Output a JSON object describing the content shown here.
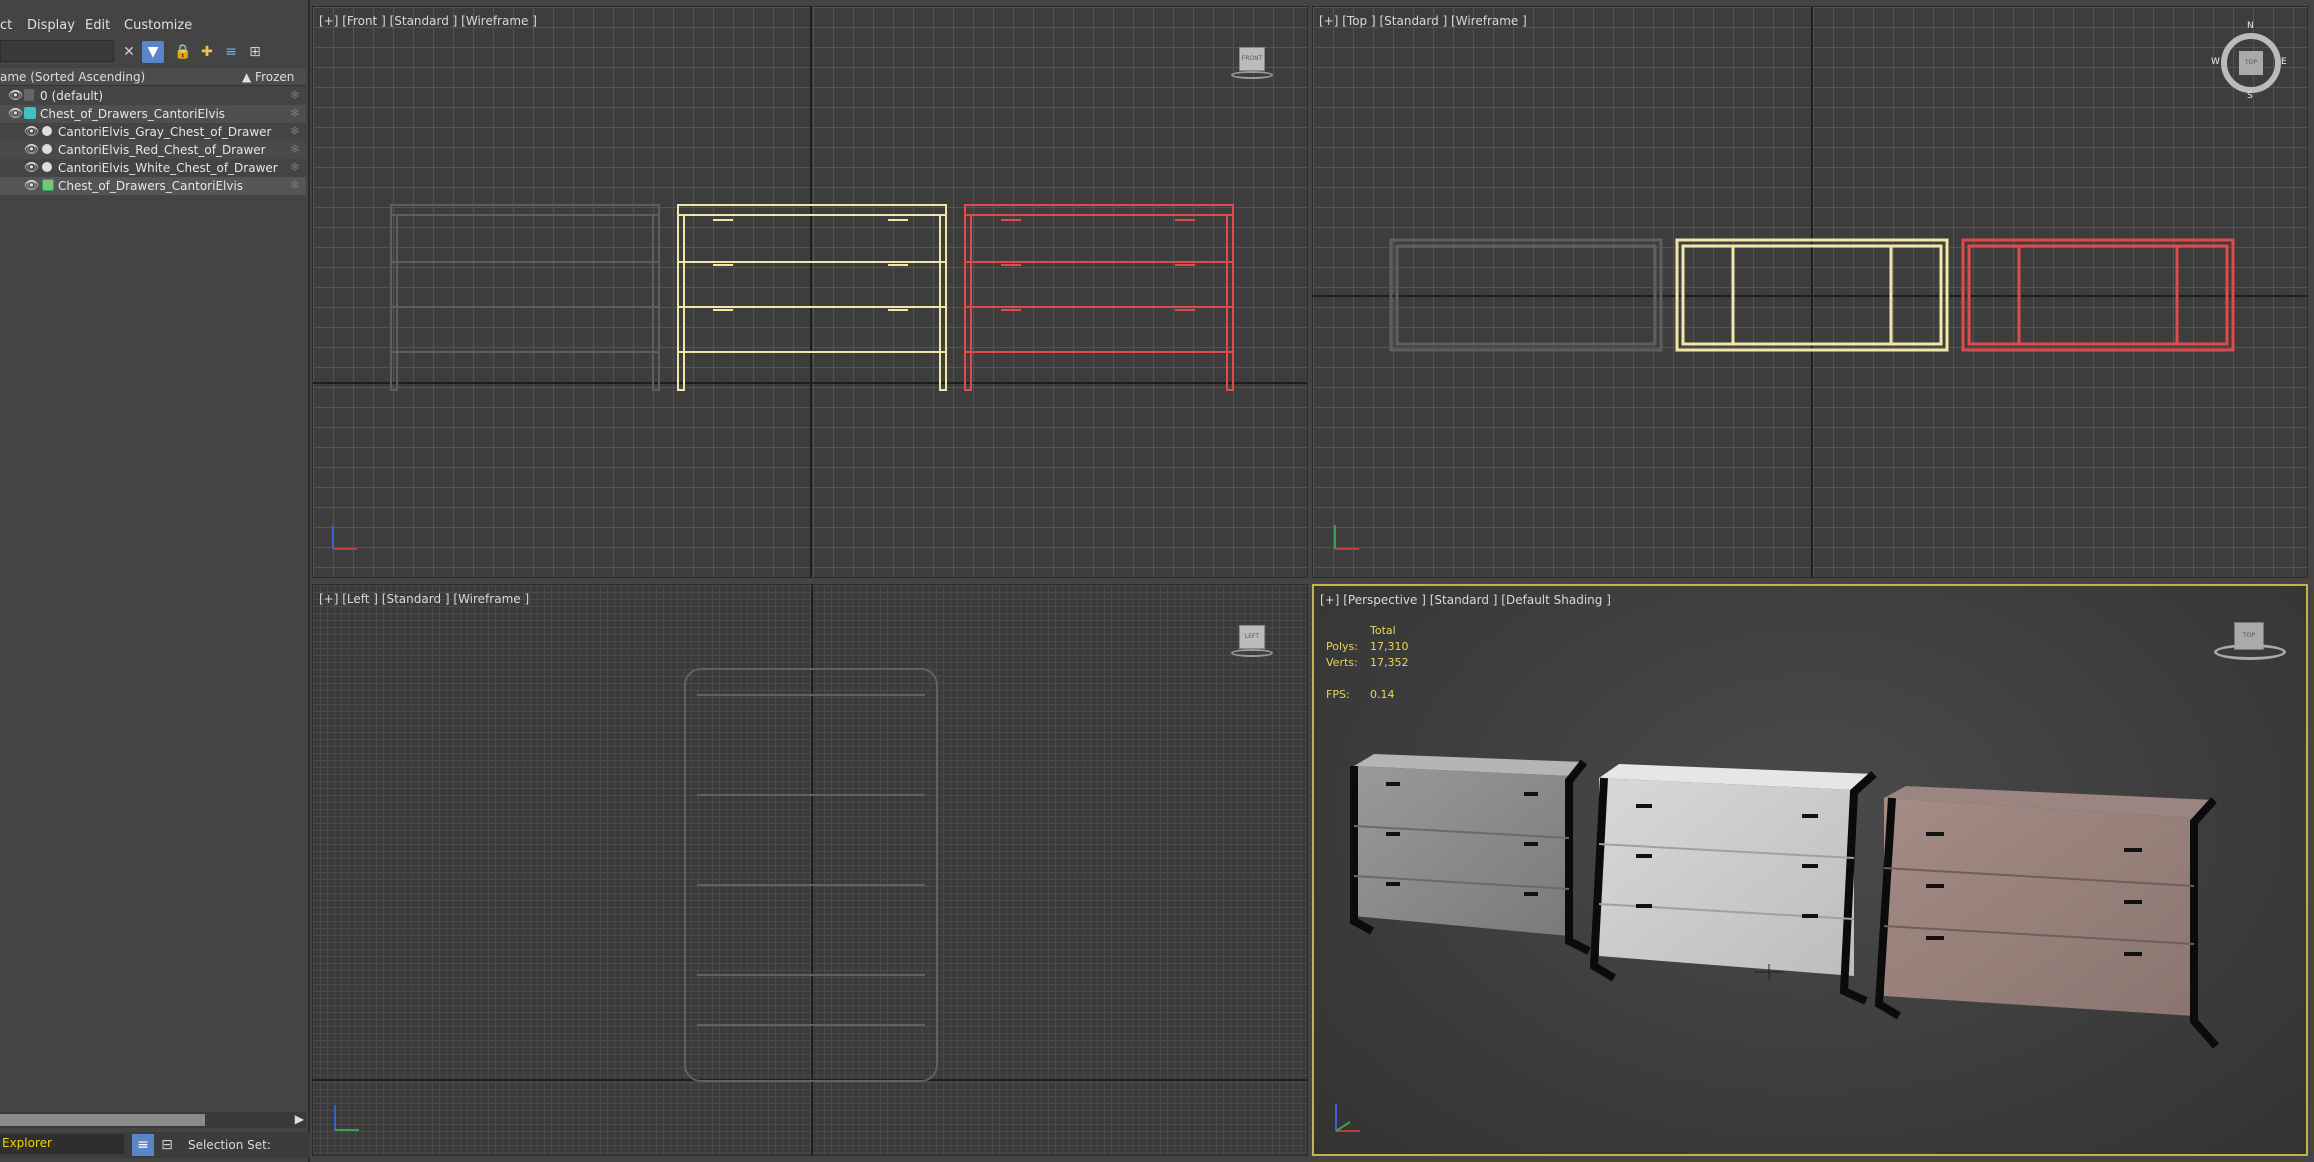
{
  "menu": {
    "items": [
      "ct",
      "Display",
      "Edit",
      "Customize"
    ]
  },
  "scene_explorer": {
    "column_name": "ame (Sorted Ascending)",
    "column_frozen": "▲ Frozen",
    "rows": [
      {
        "label": "0 (default)",
        "indent": 0,
        "icon": "layer-icon"
      },
      {
        "label": "Chest_of_Drawers_CantoriElvis",
        "indent": 0,
        "icon": "layer-stack-icon"
      },
      {
        "label": "CantoriElvis_Gray_Chest_of_Drawer",
        "indent": 1,
        "icon": "sphere-icon"
      },
      {
        "label": "CantoriElvis_Red_Chest_of_Drawer",
        "indent": 1,
        "icon": "sphere-icon"
      },
      {
        "label": "CantoriElvis_White_Chest_of_Drawer",
        "indent": 1,
        "icon": "sphere-icon"
      },
      {
        "label": "Chest_of_Drawers_CantoriElvis",
        "indent": 1,
        "icon": "group-icon"
      }
    ],
    "explorer_label": "Explorer",
    "selection_set_label": "Selection Set:"
  },
  "viewports": {
    "front": {
      "label": "[+] [Front ] [Standard ] [Wireframe ]"
    },
    "top": {
      "label": "[+] [Top ] [Standard ] [Wireframe ]"
    },
    "left": {
      "label": "[+] [Left ] [Standard ] [Wireframe ]"
    },
    "perspective": {
      "label": "[+] [Perspective ] [Standard ] [Default Shading ]",
      "stats": {
        "total_label": "Total",
        "polys_label": "Polys:",
        "polys": "17,310",
        "verts_label": "Verts:",
        "verts": "17,352",
        "fps_label": "FPS:",
        "fps": "0.14"
      }
    }
  },
  "viewcube": {
    "front": "FRONT",
    "top": "TOP",
    "left": "LEFT",
    "compass": [
      "N",
      "E",
      "S",
      "W"
    ]
  },
  "colors": {
    "gray_obj": "#5a5a5a",
    "white_obj": "#efe6a8",
    "red_obj": "#e04a4a",
    "active_border": "#c8b14a",
    "stats_text": "#e9d65a"
  }
}
